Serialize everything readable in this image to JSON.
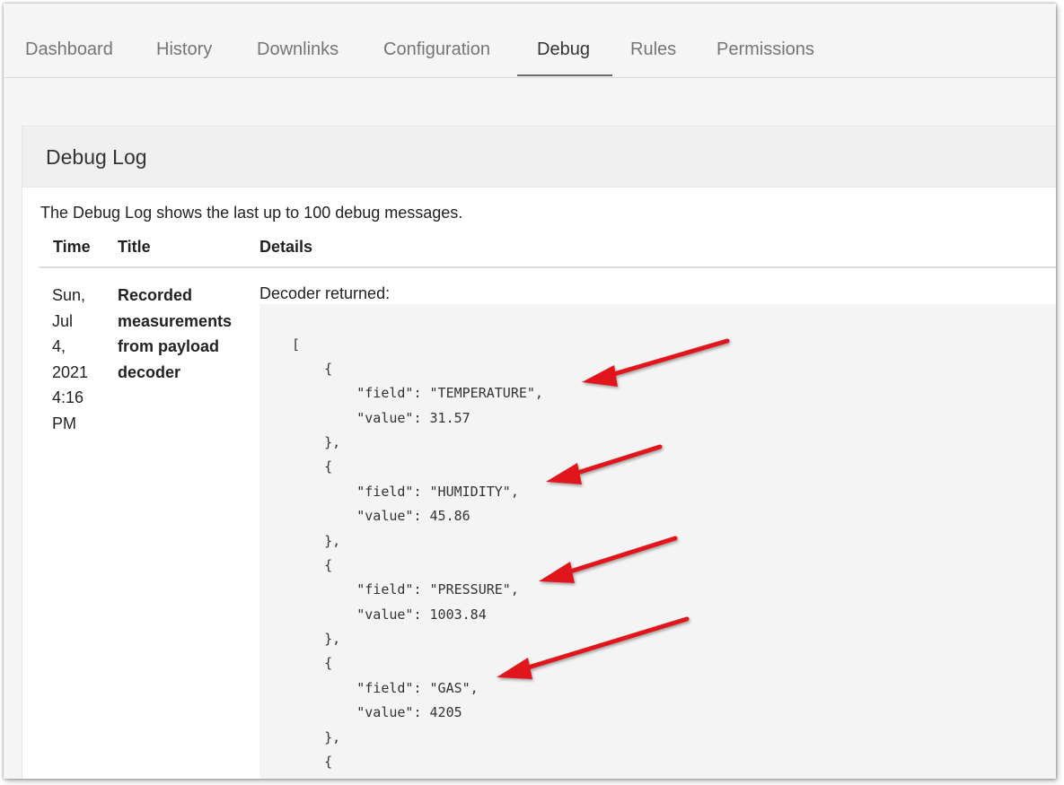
{
  "tabs": [
    {
      "label": "Dashboard"
    },
    {
      "label": "History"
    },
    {
      "label": "Downlinks"
    },
    {
      "label": "Configuration"
    },
    {
      "label": "Debug"
    },
    {
      "label": "Rules"
    },
    {
      "label": "Permissions"
    }
  ],
  "active_tab": "Debug",
  "panel": {
    "title": "Debug Log",
    "intro": "The Debug Log shows the last up to 100 debug messages.",
    "columns": [
      "Time",
      "Title",
      "Details"
    ]
  },
  "rows": [
    {
      "time_lines": [
        "Sun,",
        "Jul",
        "4,",
        "2021",
        "4:16",
        "PM"
      ],
      "title_lines": [
        "Recorded",
        "measurements",
        "from payload",
        "decoder"
      ],
      "details_label": "Decoder returned:",
      "code_lines": [
        "[",
        "    {",
        "        \"field\": \"TEMPERATURE\",",
        "        \"value\": 31.57",
        "    },",
        "    {",
        "        \"field\": \"HUMIDITY\",",
        "        \"value\": 45.86",
        "    },",
        "    {",
        "        \"field\": \"PRESSURE\",",
        "        \"value\": 1003.84",
        "    },",
        "    {",
        "        \"field\": \"GAS\",",
        "        \"value\": 4205",
        "    },",
        "    {"
      ]
    }
  ],
  "annotation_color": "#e0191e"
}
